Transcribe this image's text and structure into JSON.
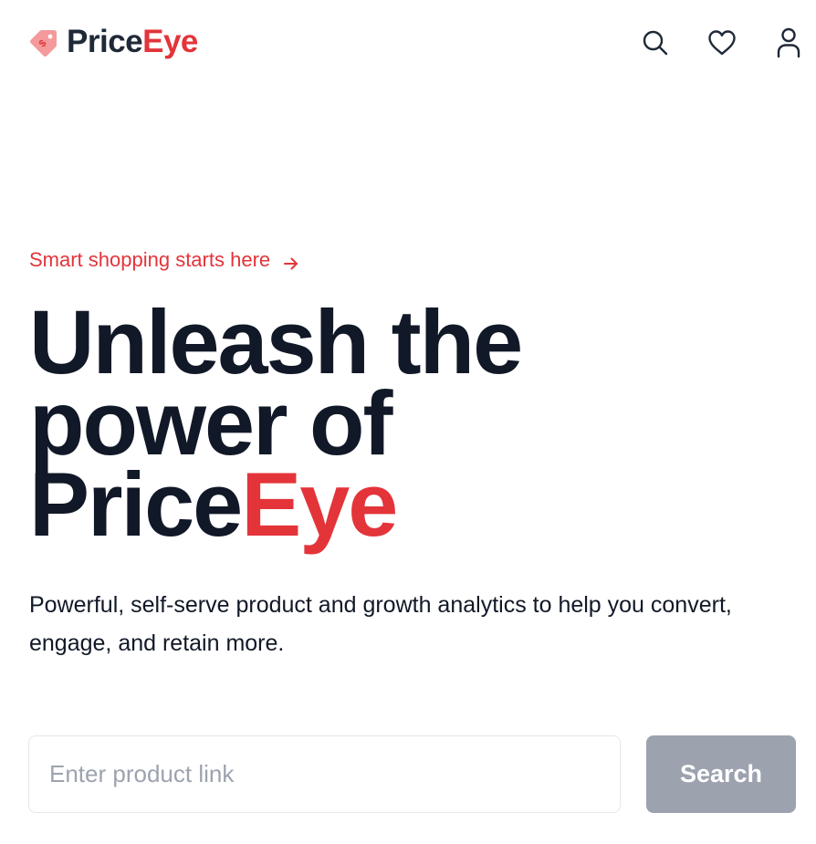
{
  "header": {
    "brand_primary": "Price",
    "brand_accent": "Eye",
    "icons": {
      "logo": "price-tag-icon",
      "search": "search-icon",
      "favorites": "heart-icon",
      "account": "user-icon"
    }
  },
  "hero": {
    "eyebrow": "Smart shopping starts here",
    "eyebrow_icon": "arrow-right-icon",
    "headline_line1": "Unleash the",
    "headline_line2": "power of",
    "headline_brand_primary": "Price",
    "headline_brand_accent": "Eye",
    "subtitle": "Powerful, self-serve product and growth analytics to help you convert, engage, and retain more."
  },
  "search": {
    "value": "",
    "placeholder": "Enter product link",
    "button_label": "Search"
  },
  "colors": {
    "accent": "#e3343a",
    "logo_tag": "#f49a9c",
    "text_dark": "#111827",
    "button_disabled": "#9ca3af",
    "input_border": "#e5e7eb"
  }
}
